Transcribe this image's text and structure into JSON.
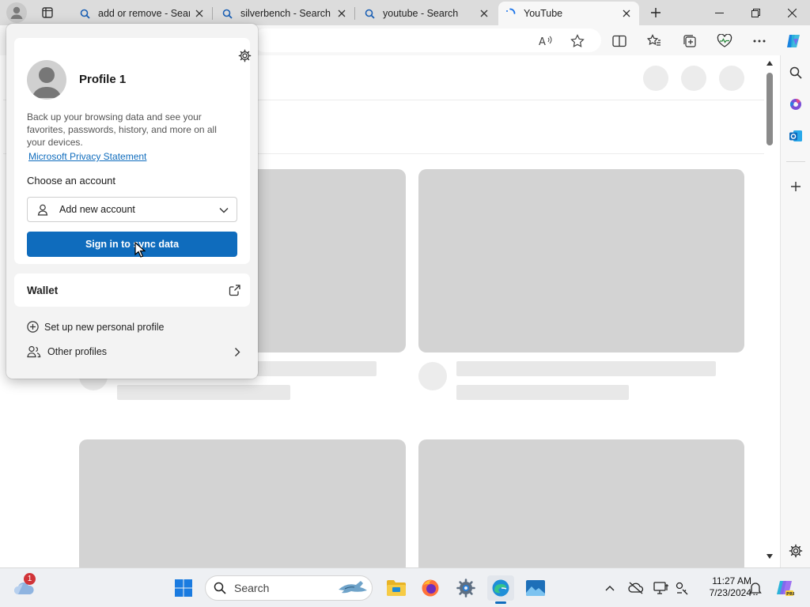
{
  "tabs": [
    {
      "label": "add or remove - Search",
      "icon": "search-icon"
    },
    {
      "label": "silverbench - Search",
      "icon": "search-icon"
    },
    {
      "label": "youtube - Search",
      "icon": "search-icon"
    },
    {
      "label": "YouTube",
      "icon": "loading-spinner-icon",
      "active": true
    }
  ],
  "profile_panel": {
    "name": "Profile 1",
    "description": "Back up your browsing data and see your favorites, passwords, history, and more on all your devices.",
    "privacy_link": "Microsoft Privacy Statement",
    "choose_account_label": "Choose an account",
    "account_dropdown_value": "Add new account",
    "sign_in_button": "Sign in to sync data",
    "wallet_label": "Wallet",
    "new_profile_label": "Set up new personal profile",
    "other_profiles_label": "Other profiles"
  },
  "taskbar": {
    "search_placeholder": "Search",
    "weather_badge": "1",
    "time": "11:27 AM",
    "date": "7/23/2024"
  },
  "colors": {
    "accent": "#0f6cbd",
    "skeleton": "#d3d3d3",
    "skeleton_light": "#e8e8e8"
  }
}
